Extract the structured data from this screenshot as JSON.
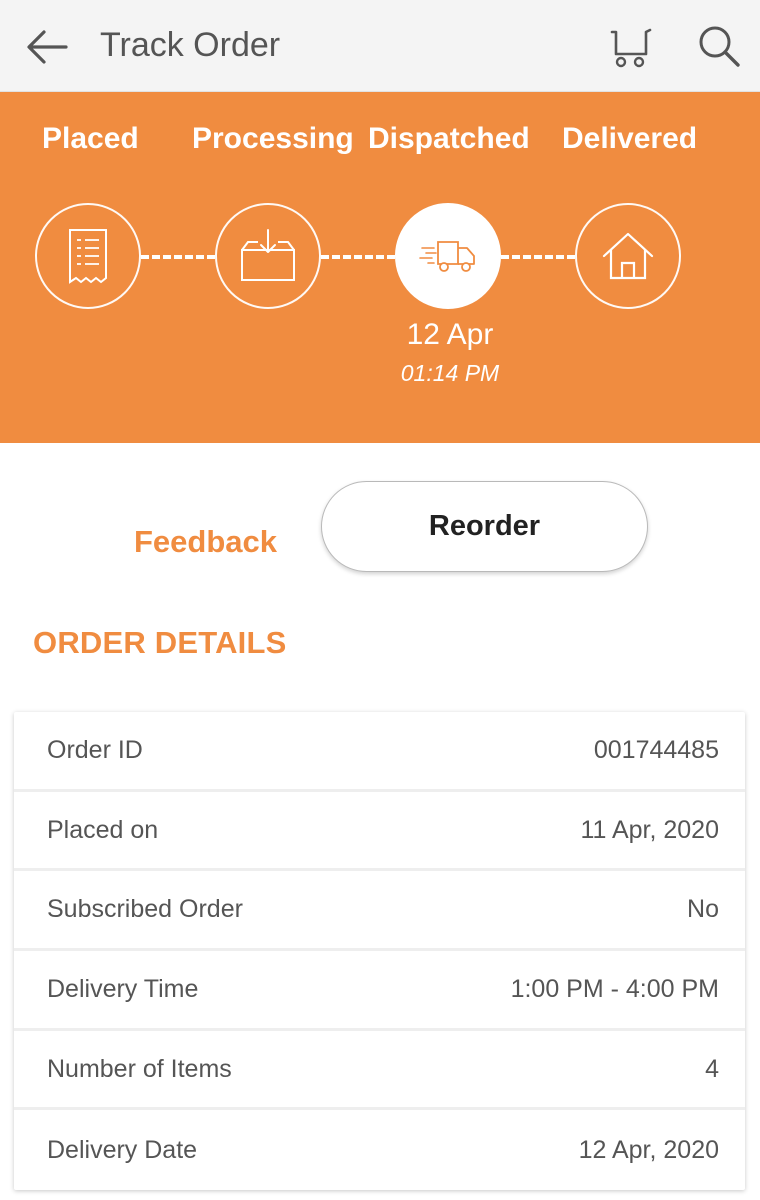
{
  "appbar": {
    "title": "Track Order",
    "icons": {
      "back": "arrow-left-icon",
      "cart": "cart-icon",
      "search": "search-icon"
    }
  },
  "tracker": {
    "steps": [
      {
        "label": "Placed",
        "icon": "receipt-icon",
        "status": "completed"
      },
      {
        "label": "Processing",
        "icon": "box-icon",
        "status": "completed"
      },
      {
        "label": "Dispatched",
        "icon": "truck-icon",
        "status": "current"
      },
      {
        "label": "Delivered",
        "icon": "home-icon",
        "status": "pending"
      }
    ],
    "current_date": "12 Apr",
    "current_time": "01:14 PM"
  },
  "actions": {
    "feedback_label": "Feedback",
    "reorder_label": "Reorder"
  },
  "order_details": {
    "title": "ORDER DETAILS",
    "rows": [
      {
        "label": "Order ID",
        "value": "001744485"
      },
      {
        "label": "Placed on",
        "value": "11 Apr, 2020"
      },
      {
        "label": "Subscribed Order",
        "value": "No"
      },
      {
        "label": "Delivery Time",
        "value": "1:00 PM - 4:00 PM"
      },
      {
        "label": "Number of Items",
        "value": "4"
      },
      {
        "label": "Delivery Date",
        "value": "12 Apr, 2020"
      }
    ]
  },
  "colors": {
    "accent": "#f08c40",
    "appbar_bg": "#f4f4f4",
    "text": "#555555"
  }
}
